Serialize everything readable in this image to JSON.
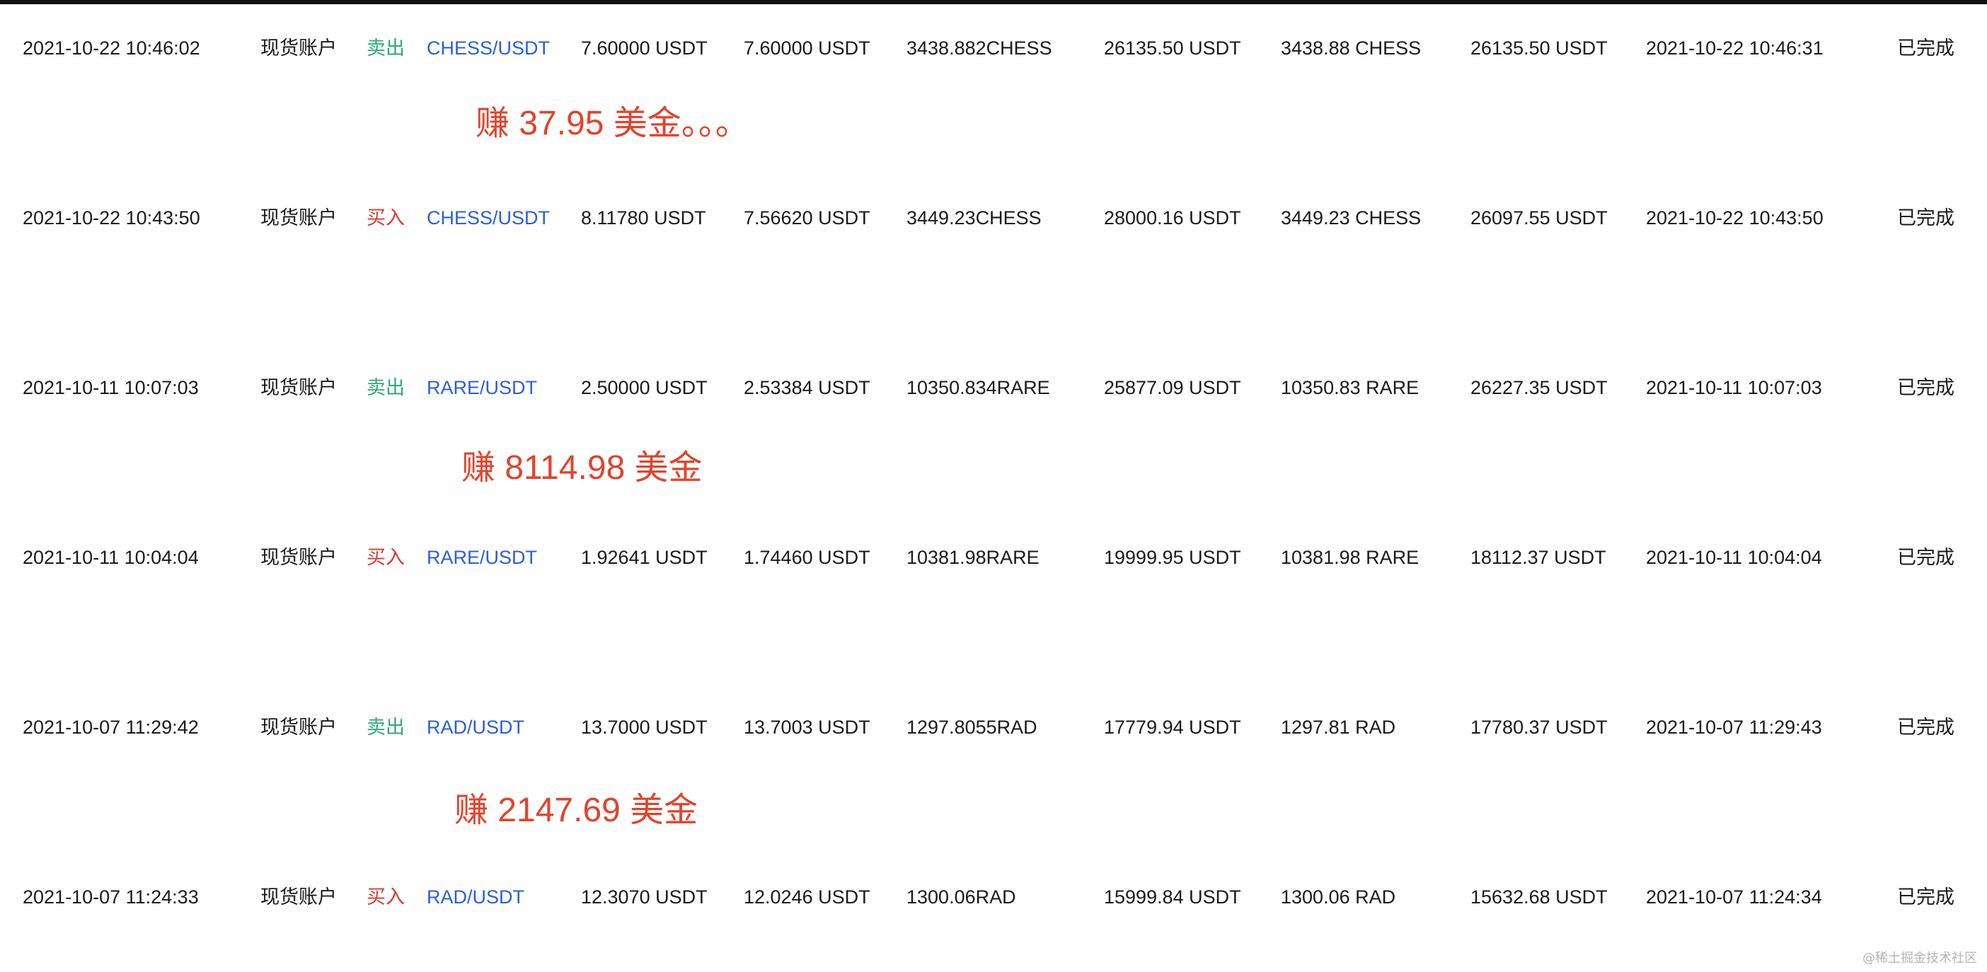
{
  "orders": [
    {
      "time": "2021-10-22 10:46:02",
      "account": "现货账户",
      "side": "卖出",
      "side_type": "sell",
      "pair": "CHESS/USDT",
      "price": "7.60000 USDT",
      "avg_price": "7.60000 USDT",
      "qty": "3438.882CHESS",
      "amount": "26135.50 USDT",
      "filled": "3438.88 CHESS",
      "total": "26135.50 USDT",
      "done_time": "2021-10-22 10:46:31",
      "status": "已完成"
    },
    {
      "time": "2021-10-22 10:43:50",
      "account": "现货账户",
      "side": "买入",
      "side_type": "buy",
      "pair": "CHESS/USDT",
      "price": "8.11780 USDT",
      "avg_price": "7.56620 USDT",
      "qty": "3449.23CHESS",
      "amount": "28000.16 USDT",
      "filled": "3449.23 CHESS",
      "total": "26097.55 USDT",
      "done_time": "2021-10-22 10:43:50",
      "status": "已完成"
    },
    {
      "time": "2021-10-11 10:07:03",
      "account": "现货账户",
      "side": "卖出",
      "side_type": "sell",
      "pair": "RARE/USDT",
      "price": "2.50000 USDT",
      "avg_price": "2.53384 USDT",
      "qty": "10350.834RARE",
      "amount": "25877.09 USDT",
      "filled": "10350.83 RARE",
      "total": "26227.35 USDT",
      "done_time": "2021-10-11 10:07:03",
      "status": "已完成"
    },
    {
      "time": "2021-10-11 10:04:04",
      "account": "现货账户",
      "side": "买入",
      "side_type": "buy",
      "pair": "RARE/USDT",
      "price": "1.92641 USDT",
      "avg_price": "1.74460 USDT",
      "qty": "10381.98RARE",
      "amount": "19999.95 USDT",
      "filled": "10381.98 RARE",
      "total": "18112.37 USDT",
      "done_time": "2021-10-11 10:04:04",
      "status": "已完成"
    },
    {
      "time": "2021-10-07 11:29:42",
      "account": "现货账户",
      "side": "卖出",
      "side_type": "sell",
      "pair": "RAD/USDT",
      "price": "13.7000 USDT",
      "avg_price": "13.7003 USDT",
      "qty": "1297.8055RAD",
      "amount": "17779.94 USDT",
      "filled": "1297.81 RAD",
      "total": "17780.37 USDT",
      "done_time": "2021-10-07 11:29:43",
      "status": "已完成"
    },
    {
      "time": "2021-10-07 11:24:33",
      "account": "现货账户",
      "side": "买入",
      "side_type": "buy",
      "pair": "RAD/USDT",
      "price": "12.3070 USDT",
      "avg_price": "12.0246 USDT",
      "qty": "1300.06RAD",
      "amount": "15999.84 USDT",
      "filled": "1300.06 RAD",
      "total": "15632.68 USDT",
      "done_time": "2021-10-07 11:24:34",
      "status": "已完成"
    }
  ],
  "annotations": {
    "chess_profit": "赚 37.95 美金。。。",
    "rare_profit": "赚 8114.98 美金",
    "rad_profit": "赚 2147.69 美金"
  },
  "watermark": "@稀土掘金技术社区",
  "colors": {
    "sell": "#2ea876",
    "buy": "#d93a33",
    "pair": "#2b5fd9",
    "annotation": "#e0442d"
  }
}
